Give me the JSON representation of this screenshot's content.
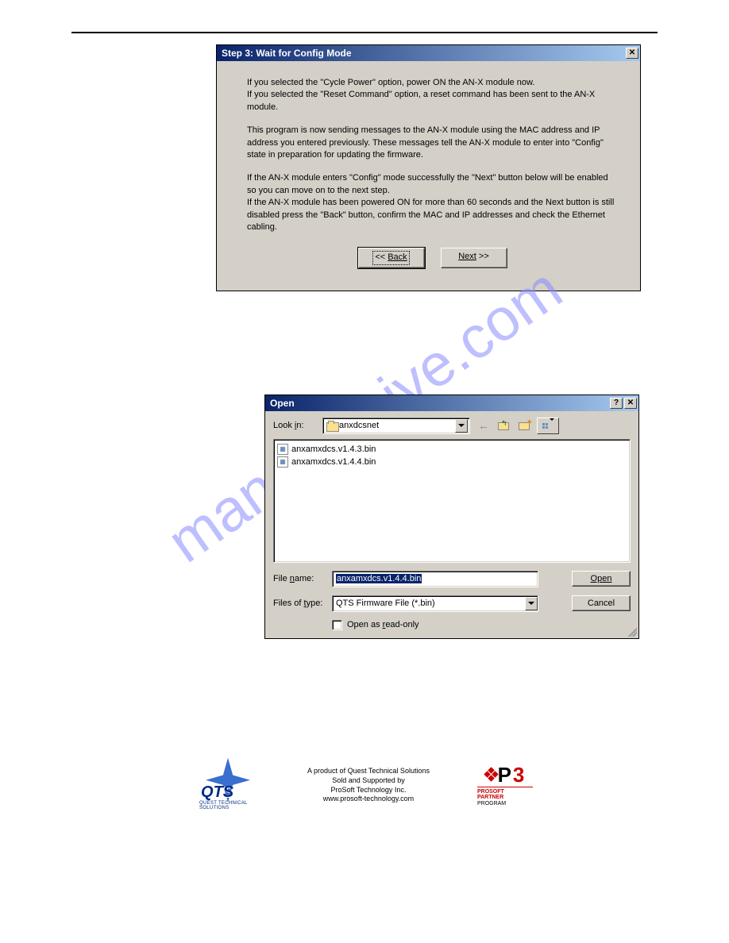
{
  "watermark": "manualshive.com",
  "wizard": {
    "title": "Step 3: Wait for Config Mode",
    "p1": "If you selected the \"Cycle Power\" option, power ON the AN-X module now.\nIf you selected the \"Reset Command\" option, a reset command has been sent to the AN-X module.",
    "p2": "This program is now sending messages to the AN-X module using the MAC address and IP address you entered previously. These messages tell the AN-X module to enter into \"Config\" state in preparation for updating the firmware.",
    "p3": "If the AN-X module enters \"Config\" mode successfully the \"Next\" button below will be enabled so you can move on to the next step.\nIf the AN-X module has been powered ON for more than 60 seconds and the Next button is still disabled press the \"Back\" button, confirm the MAC and IP addresses and check the Ethernet cabling.",
    "back_prefix": "<< ",
    "back_label": "Back",
    "next_label": "Next",
    "next_suffix": " >>"
  },
  "open": {
    "title": "Open",
    "lookin_label": "Look in:",
    "lookin_value": "anxdcsnet",
    "files": [
      "anxamxdcs.v1.4.3.bin",
      "anxamxdcs.v1.4.4.bin"
    ],
    "filename_label": "File name:",
    "filename_value": "anxamxdcs.v1.4.4.bin",
    "filetype_label": "Files of type:",
    "filetype_value": "QTS Firmware File (*.bin)",
    "open_label": "Open",
    "cancel_label": "Cancel",
    "readonly_label": "Open as read-only"
  },
  "footer": {
    "qts_name": "QTS",
    "qts_sub": "QUEST TECHNICAL SOLUTIONS",
    "line1": "A product of Quest Technical Solutions",
    "line2": "Sold and Supported by",
    "line3": "ProSoft Technology Inc.",
    "line4": "www.prosoft-technology.com",
    "p3_line1": "PROSOFT",
    "p3_line2": "PARTNER",
    "p3_line3": "PROGRAM"
  }
}
